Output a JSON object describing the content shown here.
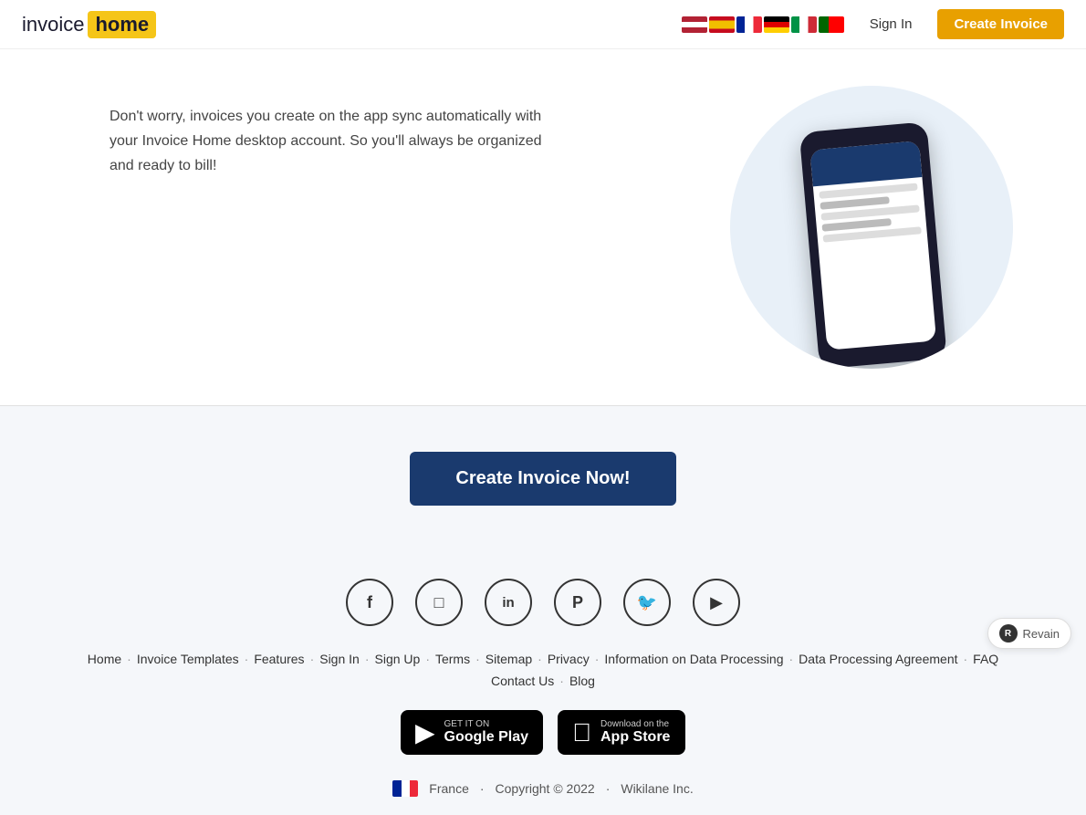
{
  "header": {
    "logo_invoice": "invoice",
    "logo_home": "home",
    "sign_in_label": "Sign In",
    "create_invoice_label": "Create Invoice",
    "flags": [
      {
        "name": "us-flag",
        "label": "English"
      },
      {
        "name": "es-flag",
        "label": "Spanish"
      },
      {
        "name": "fr-flag",
        "label": "French"
      },
      {
        "name": "de-flag",
        "label": "German"
      },
      {
        "name": "it-flag",
        "label": "Italian"
      },
      {
        "name": "pt-flag",
        "label": "Portuguese"
      }
    ]
  },
  "main": {
    "description": "Don't worry, invoices you create on the app sync automatically with your Invoice Home desktop account. So you'll always be organized and ready to bill!"
  },
  "cta": {
    "button_label": "Create Invoice Now!"
  },
  "footer": {
    "social": [
      {
        "name": "facebook-icon",
        "symbol": "f"
      },
      {
        "name": "instagram-icon",
        "symbol": "📷"
      },
      {
        "name": "linkedin-icon",
        "symbol": "in"
      },
      {
        "name": "pinterest-icon",
        "symbol": "P"
      },
      {
        "name": "twitter-icon",
        "symbol": "🐦"
      },
      {
        "name": "youtube-icon",
        "symbol": "▶"
      }
    ],
    "links": [
      {
        "label": "Home",
        "name": "home-link"
      },
      {
        "label": "Invoice Templates",
        "name": "invoice-templates-link"
      },
      {
        "label": "Features",
        "name": "features-link"
      },
      {
        "label": "Sign In",
        "name": "sign-in-footer-link"
      },
      {
        "label": "Sign Up",
        "name": "sign-up-link"
      },
      {
        "label": "Terms",
        "name": "terms-link"
      },
      {
        "label": "Sitemap",
        "name": "sitemap-link"
      },
      {
        "label": "Privacy",
        "name": "privacy-link"
      },
      {
        "label": "Information on Data Processing",
        "name": "data-processing-link"
      },
      {
        "label": "Data Processing Agreement",
        "name": "data-processing-agreement-link"
      },
      {
        "label": "FAQ",
        "name": "faq-link"
      }
    ],
    "links_row2": [
      {
        "label": "Contact Us",
        "name": "contact-us-link"
      },
      {
        "label": "Blog",
        "name": "blog-link"
      }
    ],
    "google_play_label": "Google Play",
    "app_store_label": "App Store",
    "google_play_small": "GET IT ON",
    "app_store_small": "Download on the",
    "country": "France",
    "copyright": "Copyright © 2022",
    "company": "Wikilane Inc."
  },
  "revain": {
    "label": "Revain"
  }
}
